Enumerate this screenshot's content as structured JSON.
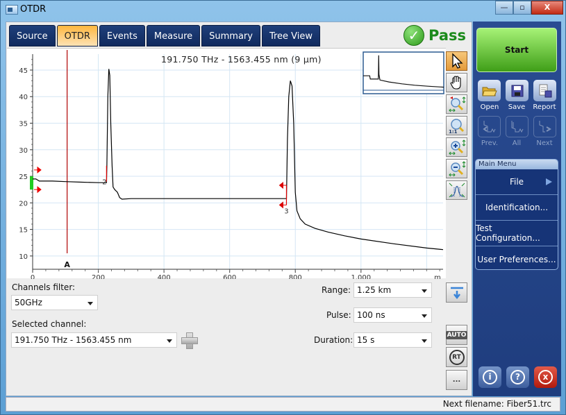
{
  "window": {
    "title": "OTDR",
    "minimize": "—",
    "maximize": "▫",
    "close": "X"
  },
  "tabs": [
    {
      "label": "Source",
      "active": false
    },
    {
      "label": "OTDR",
      "active": true
    },
    {
      "label": "Events",
      "active": false
    },
    {
      "label": "Measure",
      "active": false
    },
    {
      "label": "Summary",
      "active": false
    },
    {
      "label": "Tree View",
      "active": false
    }
  ],
  "status": {
    "result": "Pass",
    "icon": "checkmark-icon",
    "color": "#1b8a1b"
  },
  "chart_data": {
    "type": "line",
    "title": "191.750 THz - 1563.455 nm (9 µm)",
    "xlabel": "m",
    "ylabel": "",
    "xlim": [
      0,
      1250
    ],
    "ylim": [
      7.5,
      48
    ],
    "x_ticks": [
      "0",
      "200",
      "400",
      "600",
      "800",
      "1,000"
    ],
    "y_ticks": [
      "10",
      "15",
      "20",
      "25",
      "30",
      "35",
      "40",
      "45"
    ],
    "grid": true,
    "series": [
      {
        "name": "trace",
        "color": "#000000",
        "x": [
          0,
          10,
          20,
          60,
          100,
          150,
          200,
          225,
          226,
          229,
          232,
          235,
          238,
          242,
          245,
          250,
          258,
          265,
          272,
          300,
          400,
          500,
          600,
          700,
          773,
          776,
          780,
          785,
          790,
          795,
          800,
          805,
          815,
          830,
          860,
          900,
          950,
          1000,
          1100,
          1200,
          1250
        ],
        "y": [
          24.5,
          24.5,
          24.1,
          24.1,
          24.0,
          23.9,
          23.8,
          23.8,
          27.0,
          40.0,
          45.2,
          44.0,
          35.0,
          27.0,
          23.0,
          22.5,
          22.0,
          21.0,
          20.7,
          20.8,
          20.8,
          20.8,
          20.8,
          20.8,
          20.8,
          32.0,
          40.0,
          43.0,
          42.0,
          35.0,
          22.0,
          18.5,
          17.0,
          16.0,
          15.2,
          14.5,
          13.8,
          13.2,
          12.3,
          11.5,
          11.2
        ]
      }
    ],
    "markers": [
      {
        "label": "A",
        "x": 105,
        "color": "#b00000",
        "type": "cursor"
      },
      {
        "label": "2",
        "x": 225,
        "y": 24.0,
        "type": "event"
      },
      {
        "label": "3",
        "x": 773,
        "y": 19.6,
        "type": "event"
      }
    ],
    "launch_level_range": [
      22.5,
      25
    ],
    "overview": {
      "visible": true
    }
  },
  "tools": [
    {
      "name": "pointer-tool",
      "icon": "cursor-arrow-icon",
      "active": true
    },
    {
      "name": "pan-tool",
      "icon": "hand-icon",
      "active": false
    },
    {
      "name": "zoom-auto-tool",
      "icon": "zoom-area-icon",
      "active": false
    },
    {
      "name": "zoom-1to1-tool",
      "icon": "zoom-1to1-icon",
      "active": false,
      "label": "1:1"
    },
    {
      "name": "zoom-in-tool",
      "icon": "zoom-in-icon",
      "active": false
    },
    {
      "name": "zoom-out-tool",
      "icon": "zoom-out-icon",
      "active": false
    },
    {
      "name": "fit-tool",
      "icon": "fit-trace-icon",
      "active": false
    }
  ],
  "controls": {
    "channels_filter": {
      "label": "Channels filter:",
      "value": "50GHz"
    },
    "selected_channel": {
      "label": "Selected channel:",
      "value": "191.750 THz - 1563.455 nm"
    },
    "range": {
      "label": "Range:",
      "value": "1.25 km"
    },
    "pulse": {
      "label": "Pulse:",
      "value": "100 ns"
    },
    "duration": {
      "label": "Duration:",
      "value": "15 s"
    },
    "auto_label": "AUTO",
    "rt_label": "RT",
    "more_label": "..."
  },
  "sidebar": {
    "start": "Start",
    "actions": [
      {
        "label": "Open",
        "icon": "folder-open-icon",
        "enabled": true
      },
      {
        "label": "Save",
        "icon": "floppy-disk-icon",
        "enabled": true
      },
      {
        "label": "Report",
        "icon": "report-icon",
        "enabled": true
      },
      {
        "label": "Prev.",
        "icon": "prev-trace-icon",
        "enabled": false
      },
      {
        "label": "All",
        "icon": "all-traces-icon",
        "enabled": false
      },
      {
        "label": "Next",
        "icon": "next-trace-icon",
        "enabled": false
      }
    ],
    "menu": {
      "title": "Main Menu",
      "items": [
        "File",
        "Identification...",
        "Test Configuration...",
        "User Preferences..."
      ]
    },
    "bottom": {
      "info": "i",
      "help": "?",
      "exit": "x"
    }
  },
  "statusbar": {
    "text": "Next filename: Fiber51.trc"
  }
}
